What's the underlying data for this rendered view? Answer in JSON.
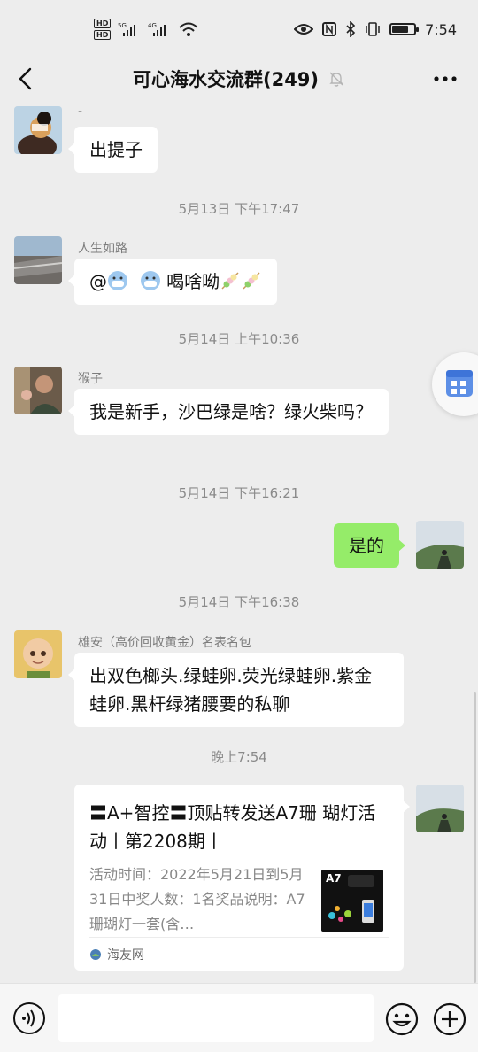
{
  "status_bar": {
    "time": "7:54",
    "network_left": "5G",
    "network_right": "4G",
    "battery_level": 0.75
  },
  "header": {
    "title": "可心海水交流群(249)",
    "back_icon": "chevron-left-icon",
    "mute_icon": "bell-off-icon",
    "more_icon": "more-dots-icon"
  },
  "messages": [
    {
      "type": "incoming",
      "sender": "-",
      "text": "出提子"
    },
    {
      "type": "time",
      "text": "5月13日 下午17:47"
    },
    {
      "type": "incoming",
      "sender": "人生如路",
      "text_prefix": "@",
      "text_suffix": "喝啥呦"
    },
    {
      "type": "time",
      "text": "5月14日 上午10:36"
    },
    {
      "type": "incoming",
      "sender": "猴子",
      "text": "我是新手，沙巴绿是啥？绿火柴吗？"
    },
    {
      "type": "time",
      "text": "5月14日 下午16:21"
    },
    {
      "type": "outgoing",
      "text": "是的"
    },
    {
      "type": "time",
      "text": "5月14日 下午16:38"
    },
    {
      "type": "incoming",
      "sender": "雄安（高价回收黄金）名表名包",
      "text": "出双色榔头.绿蛙卵.荧光绿蛙卵.紫金蛙卵.黑杆绿猪腰要的私聊"
    },
    {
      "type": "time",
      "text": "晚上7:54"
    }
  ],
  "card": {
    "title": "〓A+智控〓顶贴转发送A7珊 瑚灯活动丨第2208期丨",
    "description": "活动时间：2022年5月21日到5月31日中奖人数：1名奖品说明：A7珊瑚灯一套(含…",
    "thumb_label": "A7",
    "source": "海友网"
  },
  "input_bar": {
    "voice_icon": "voice-icon",
    "emoji_icon": "emoji-icon",
    "plus_icon": "plus-circle-icon",
    "placeholder": ""
  }
}
